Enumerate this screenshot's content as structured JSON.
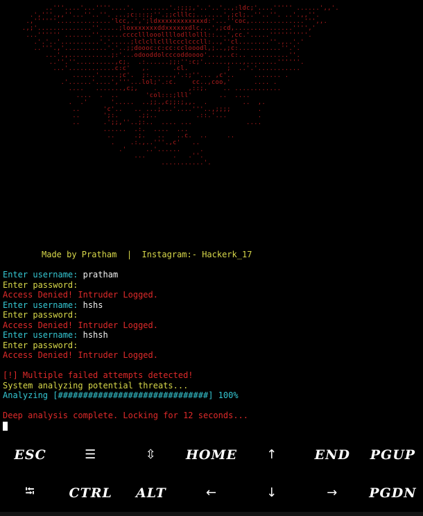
{
  "banner": {
    "ascii_art": "           ..'''....'...''''....'.  .......'.:;;;,'..'..'..,:ldc;'....''''' ......',,'.\n       .','''.,,''...''..''. ...;c:::;;''.;;clllc;.......',;cl;..''..''. ..'.,,''.\n      .,''''''..............'lcc,.',';ldxxxxxxxxxxxxd:'...''coc,..............''',,.\n     .,;'..............''.....;loxxxxxxxddxxxxxxdlc,..',;cd,...............'''','\n      ...'''''' .......''......cccclllooollllodllolll::...',cc.'.....''''''''''.\n        .'.'..'..........'.'.....;lclcllclllccclcccll:..,''cl........''.,..'.'\n        ..'''.,'...........'.'..;;doooc:c:cc:cclooodl,;..,;c:...........''.'.\n           ...'.,...........;:'...odooddolcccoddoooo'...,..c:.. ..........''.\n            ..''.''..........,c;.  .:......;;:'':c;'......,...,........''''''.\n             ...'............c:c'   ,.      .cl.          ;  ..'.'...........\n                  ......'.....;c'.  ;:......,'.:;''... ,c'..     ....... .\n               .'......'....','''...lol;'.:c.    cc..,coo,'      .... .\n                 ....   .......,c;,    .        ,::;.    .. ............\n                   ....  .  ..       'col:::;lll'       ..  ....\n                 .  .'      '.....  ..;;.,c;;:;,,.  .         ..  ,.\n                  ..      'c'..   .. ...;...'....'''..,;;;;       .\n                  ..      ';:.     .;;..          .::.'...        .\n                  ..      .';;,''..;:..  .... ...              ....\n                          ......  .:.  ....  ...\n                           ..     .;.   ..   ..c.  ..     ..\n                            .    .:.,..'''.,c'   ..\n                              .'     ..'......     .\n                                  ...       .   .''.\n                                         ...........'."
  },
  "credit": "Made by Pratham  |  Instagram:- Hackerk_17",
  "log": [
    {
      "prompt": "Enter username: ",
      "input": "pratham",
      "type": "username"
    },
    {
      "prompt": "Enter password: ",
      "input": "",
      "type": "password"
    },
    {
      "text": "Access Denied! Intruder Logged.",
      "type": "error"
    },
    {
      "prompt": "Enter username: ",
      "input": "hshs",
      "type": "username"
    },
    {
      "prompt": "Enter password: ",
      "input": "",
      "type": "password"
    },
    {
      "text": "Access Denied! Intruder Logged.",
      "type": "error"
    },
    {
      "prompt": "Enter username: ",
      "input": "hshsh",
      "type": "username"
    },
    {
      "prompt": "Enter password: ",
      "input": "",
      "type": "password"
    },
    {
      "text": "Access Denied! Intruder Logged.",
      "type": "error"
    }
  ],
  "warning": "[!] Multiple failed attempts detected!",
  "analysis_status": "System analyzing potential threats...",
  "progress": {
    "label": "Analyzing [##############################] 100%",
    "value": 1.0
  },
  "lock_message": "Deep analysis complete. Locking for 12 seconds...",
  "extra_keys": {
    "row1": [
      "ESC",
      "☰",
      "⇳",
      "HOME",
      "↑",
      "END",
      "PGUP"
    ],
    "row2": [
      "⭾",
      "CTRL",
      "ALT",
      "←",
      "↓",
      "→",
      "PGDN"
    ]
  },
  "colors": {
    "background": "#000000",
    "banner_red": "#cc2222",
    "prompt_cyan": "#35c8d4",
    "prompt_yellow": "#d8d84a",
    "error_red": "#e02a2a",
    "text_white": "#f2f2f2"
  }
}
